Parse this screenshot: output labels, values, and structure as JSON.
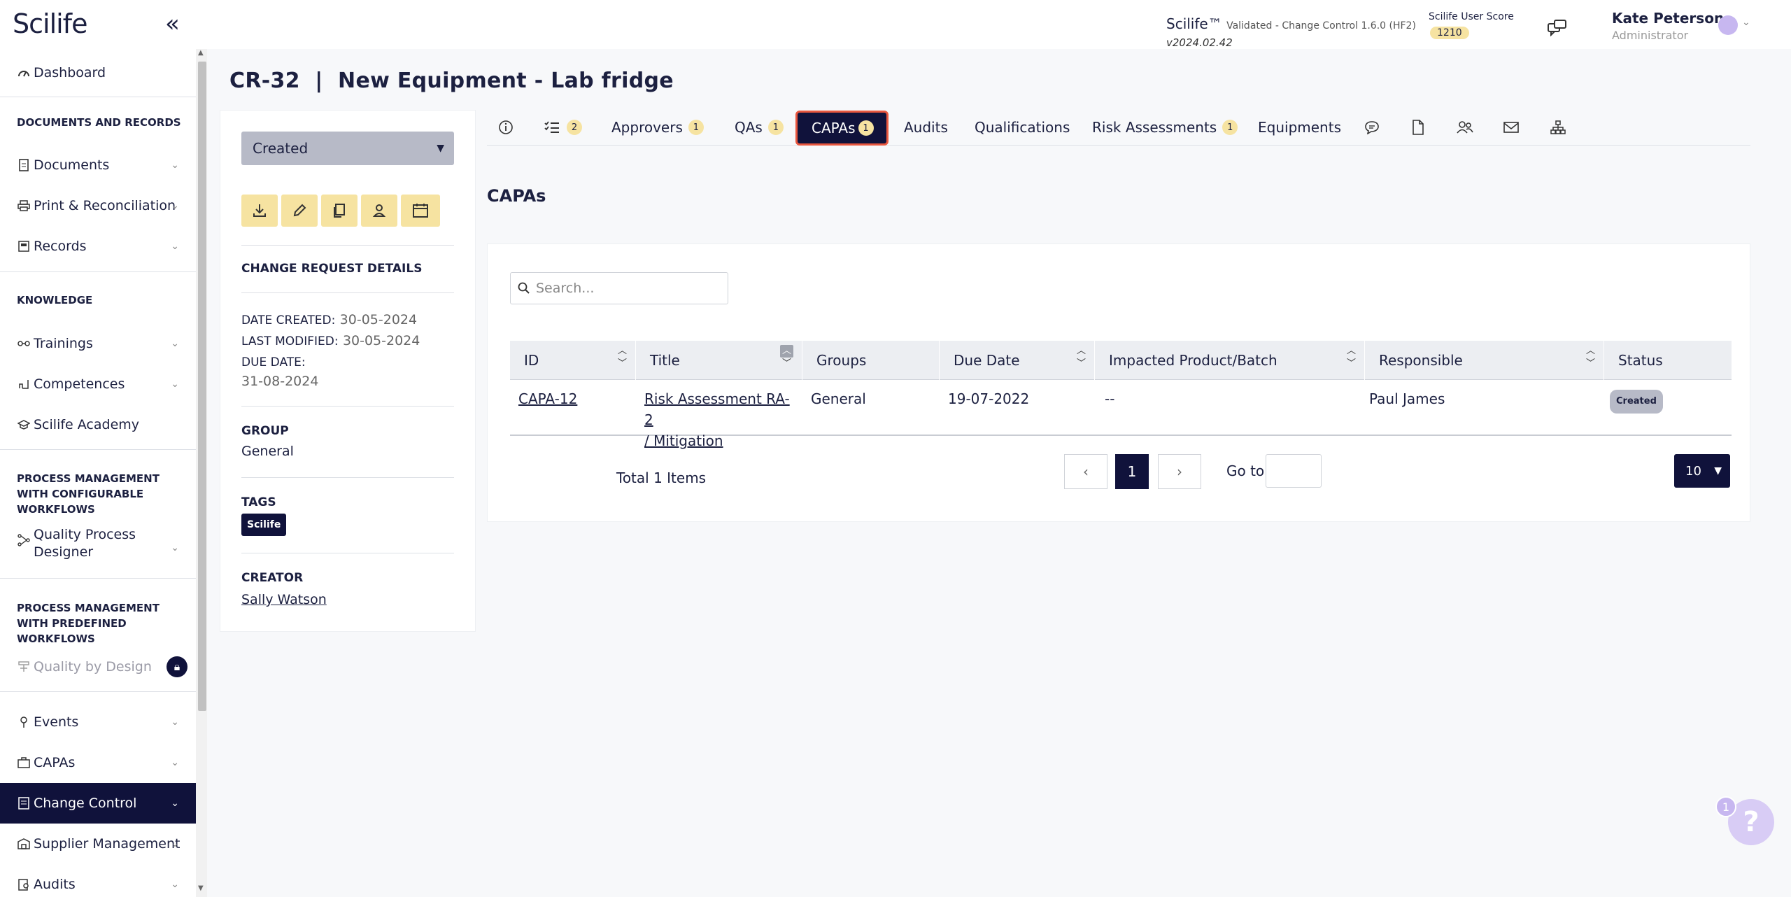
{
  "app": {
    "logo": "Scilife",
    "product_name": "Scilife™",
    "product_desc": "Validated - Change Control 1.6.0 (HF2)",
    "version": "v2024.02.42",
    "user_score_label": "Scilife User Score",
    "user_score": "1210"
  },
  "user": {
    "name": "Kate Peterson",
    "role": "Administrator"
  },
  "sidebar": {
    "items": [
      {
        "label": "Dashboard",
        "icon": "dashboard-icon"
      },
      {
        "section": "DOCUMENTS AND RECORDS"
      },
      {
        "label": "Documents",
        "icon": "document-icon",
        "expandable": true
      },
      {
        "label": "Print & Reconciliation",
        "icon": "printer-icon",
        "expandable": true
      },
      {
        "label": "Records",
        "icon": "records-icon",
        "expandable": true
      },
      {
        "section": "KNOWLEDGE"
      },
      {
        "label": "Trainings",
        "icon": "training-icon",
        "expandable": true
      },
      {
        "label": "Competences",
        "icon": "competence-icon",
        "expandable": true
      },
      {
        "label": "Scilife Academy",
        "icon": "academy-icon"
      },
      {
        "section": "PROCESS MANAGEMENT WITH CONFIGURABLE WORKFLOWS"
      },
      {
        "label": "Quality Process Designer",
        "icon": "workflow-icon",
        "expandable": true
      },
      {
        "section": "PROCESS MANAGEMENT WITH PREDEFINED WORKFLOWS"
      },
      {
        "label": "Quality by Design",
        "icon": "qbd-icon",
        "locked": true
      },
      {
        "label": "Events",
        "icon": "event-icon",
        "expandable": true
      },
      {
        "label": "CAPAs",
        "icon": "capa-icon",
        "expandable": true
      },
      {
        "label": "Change Control",
        "icon": "change-control-icon",
        "expandable": true,
        "active": true
      },
      {
        "label": "Supplier Management",
        "icon": "supplier-icon",
        "expandable": true
      },
      {
        "label": "Audits",
        "icon": "audit-icon",
        "expandable": true
      }
    ]
  },
  "page": {
    "title": "CR-32  |  New Equipment - Lab fridge"
  },
  "details": {
    "status": "Created",
    "heading": "CHANGE REQUEST DETAILS",
    "date_created_label": "DATE CREATED:",
    "date_created": "30-05-2024",
    "last_modified_label": "LAST MODIFIED:",
    "last_modified": "30-05-2024",
    "due_date_label": "DUE DATE:",
    "due_date": "31-08-2024",
    "group_label": "GROUP",
    "group": "General",
    "tags_label": "TAGS",
    "tag": "Scilife",
    "creator_label": "CREATOR",
    "creator": "Sally Watson",
    "actions": [
      "download-icon",
      "edit-icon",
      "copy-icon",
      "user-icon",
      "calendar-icon"
    ]
  },
  "tabs": [
    {
      "icon": "info-icon"
    },
    {
      "icon": "checklist-icon",
      "count": "2"
    },
    {
      "label": "Approvers",
      "count": "1"
    },
    {
      "label": "QAs",
      "count": "1"
    },
    {
      "label": "CAPAs",
      "count": "1",
      "active": true
    },
    {
      "label": "Audits"
    },
    {
      "label": "Qualifications"
    },
    {
      "label": "Risk Assessments",
      "count": "1"
    },
    {
      "label": "Equipments"
    },
    {
      "icon": "comment-icon"
    },
    {
      "icon": "file-icon"
    },
    {
      "icon": "users-icon"
    },
    {
      "icon": "mail-icon"
    },
    {
      "icon": "hierarchy-icon"
    }
  ],
  "capas": {
    "title": "CAPAs",
    "search_placeholder": "Search...",
    "columns": [
      "ID",
      "Title",
      "Groups",
      "Due Date",
      "Impacted Product/Batch",
      "Responsible",
      "Status"
    ],
    "rows": [
      {
        "id": "CAPA-12",
        "title_line1": "Risk Assessment RA-2",
        "title_line2": "/ Mitigation",
        "groups": "General",
        "due_date": "19-07-2022",
        "impacted": "--",
        "responsible": "Paul James",
        "status": "Created"
      }
    ],
    "total": "Total 1 Items",
    "current_page": "1",
    "goto_label": "Go to",
    "page_size": "10"
  },
  "help": {
    "count": "1",
    "symbol": "?"
  },
  "colors": {
    "navy": "#10123b",
    "badge_yellow": "#f6e3a1",
    "active_border": "#e8573f"
  }
}
